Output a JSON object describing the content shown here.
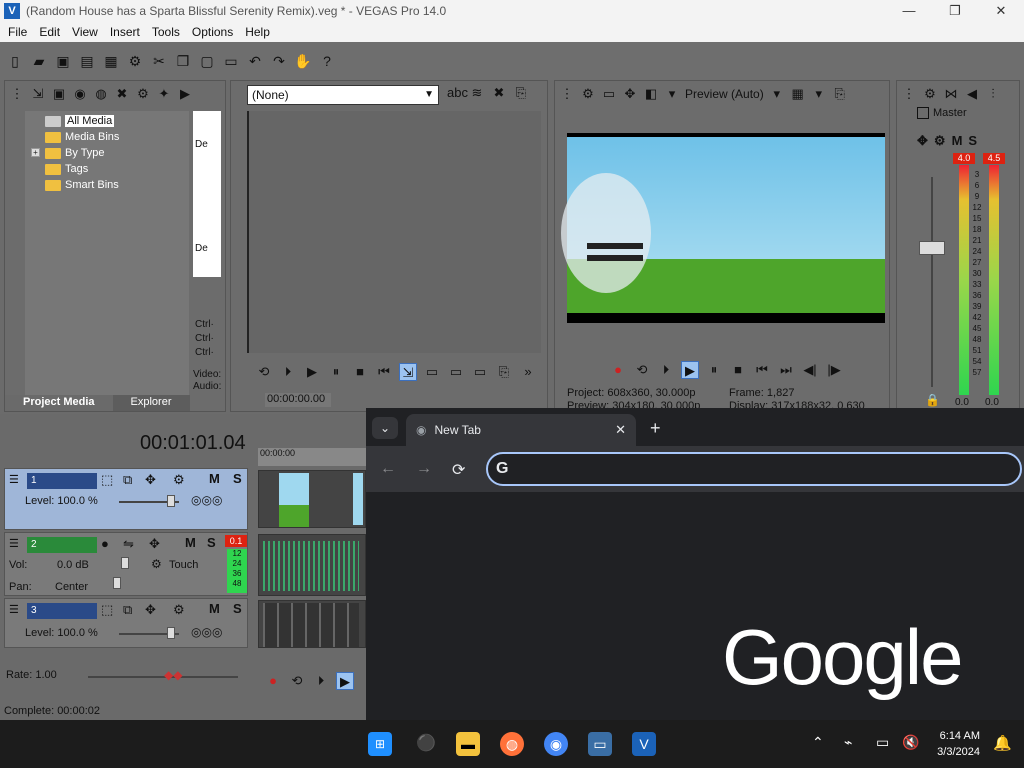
{
  "window": {
    "title": "(Random House has a Sparta Blissful Serenity Remix).veg * - VEGAS Pro 14.0",
    "app_icon": "vegas-icon",
    "controls": [
      "—",
      "❐",
      "✕"
    ]
  },
  "menu": [
    "File",
    "Edit",
    "View",
    "Insert",
    "Tools",
    "Options",
    "Help"
  ],
  "toolbar_icons": [
    "new-icon",
    "open-icon",
    "save-icon",
    "save-as-icon",
    "render-icon",
    "properties-icon",
    "cut-icon",
    "copy-icon",
    "paste-icon",
    "delete-icon",
    "undo-icon",
    "redo-icon",
    "hand-icon",
    "help-icon"
  ],
  "project_media": {
    "tree": [
      {
        "label": "All Media",
        "selected": true
      },
      {
        "label": "Media Bins"
      },
      {
        "label": "By Type",
        "expandable": true
      },
      {
        "label": "Tags"
      },
      {
        "label": "Smart Bins"
      }
    ],
    "side_labels": [
      "De",
      "De",
      "Ctrl·",
      "Ctrl·",
      "Ctrl·",
      "Video:",
      "Audio:"
    ],
    "tabs": [
      "Project Media",
      "Explorer"
    ]
  },
  "trimmer": {
    "dropdown_value": "(None)",
    "timecode": "00:00:00.00"
  },
  "preview": {
    "mode": "Preview (Auto)",
    "project_label": "Project:",
    "project_value": "608x360, 30.000p",
    "frame_label": "Frame:",
    "frame_value": "1,827",
    "preview_label": "Preview:",
    "preview_value": "304x180, 30.000p",
    "display_label": "Display:",
    "display_value": "317x188x32, 0.630"
  },
  "master": {
    "label": "Master",
    "m": "M",
    "s": "S",
    "peak_left": "4.0",
    "peak_right": "4.5",
    "scale": [
      "3",
      "6",
      "9",
      "12",
      "15",
      "18",
      "21",
      "24",
      "27",
      "30",
      "33",
      "36",
      "39",
      "42",
      "45",
      "48",
      "51",
      "54",
      "57"
    ],
    "bottom_left": "0.0",
    "bottom_right": "0.0"
  },
  "timeline": {
    "timecode": "00:01:01.04",
    "ruler_time": "00:00:00",
    "tracks": [
      {
        "num": "1",
        "level_label": "Level:",
        "level": "100.0 %",
        "m": "M",
        "s": "S"
      },
      {
        "num": "2",
        "vol_label": "Vol:",
        "vol": "0.0 dB",
        "pan_label": "Pan:",
        "pan": "Center",
        "mode": "Touch",
        "m": "M",
        "s": "S",
        "peak": "0.1",
        "meter_scale": [
          "12",
          "24",
          "36",
          "48"
        ]
      },
      {
        "num": "3",
        "level_label": "Level:",
        "level": "100.0 %",
        "m": "M",
        "s": "S"
      }
    ],
    "rate": "Rate: 1.00",
    "status": "Complete: 00:00:02"
  },
  "chrome": {
    "tab_title": "New Tab",
    "logo": "Google",
    "omnibox_placeholder": ""
  },
  "taskbar": {
    "icons": [
      "windows-start-icon",
      "search-icon",
      "file-explorer-icon",
      "firefox-icon",
      "chrome-icon",
      "remote-desktop-icon",
      "vegas-icon"
    ],
    "time": "6:14 AM",
    "date": "3/3/2024"
  }
}
